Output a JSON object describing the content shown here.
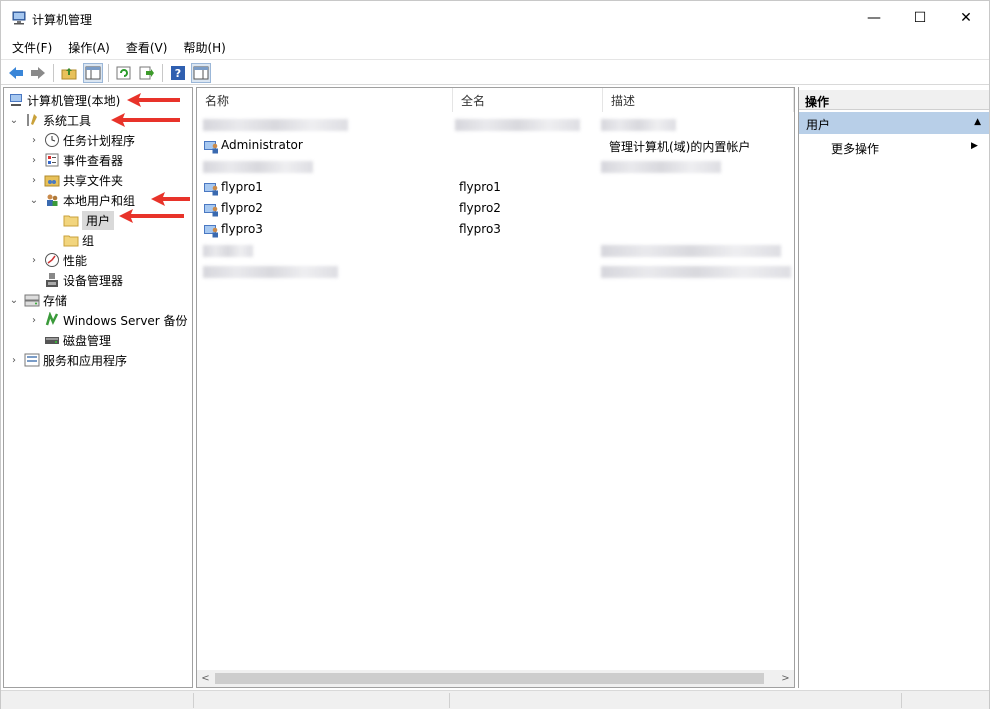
{
  "window": {
    "title": "计算机管理",
    "minimize": "—",
    "maximize": "☐",
    "close": "✕"
  },
  "menu": [
    "文件(F)",
    "操作(A)",
    "查看(V)",
    "帮助(H)"
  ],
  "tree": {
    "root": "计算机管理(本地)",
    "system_tools": "系统工具",
    "task_scheduler": "任务计划程序",
    "event_viewer": "事件查看器",
    "shared_folders": "共享文件夹",
    "local_users_groups": "本地用户和组",
    "users": "用户",
    "groups": "组",
    "performance": "性能",
    "device_manager": "设备管理器",
    "storage": "存储",
    "windows_server_backup": "Windows Server 备份",
    "disk_management": "磁盘管理",
    "services_apps": "服务和应用程序"
  },
  "list": {
    "columns": [
      "名称",
      "全名",
      "描述"
    ],
    "rows": [
      {
        "name": "Administrator",
        "full_name": "",
        "description": "管理计算机(域)的内置帐户"
      },
      {
        "name": "flypro1",
        "full_name": "flypro1",
        "description": ""
      },
      {
        "name": "flypro2",
        "full_name": "flypro2",
        "description": ""
      },
      {
        "name": "flypro3",
        "full_name": "flypro3",
        "description": ""
      }
    ]
  },
  "actions": {
    "title": "操作",
    "section": "用户",
    "more": "更多操作"
  },
  "colors": {
    "selection": "#d9d9d9",
    "action_section": "#b8cfe8",
    "annotation_arrow": "#e8332a"
  }
}
